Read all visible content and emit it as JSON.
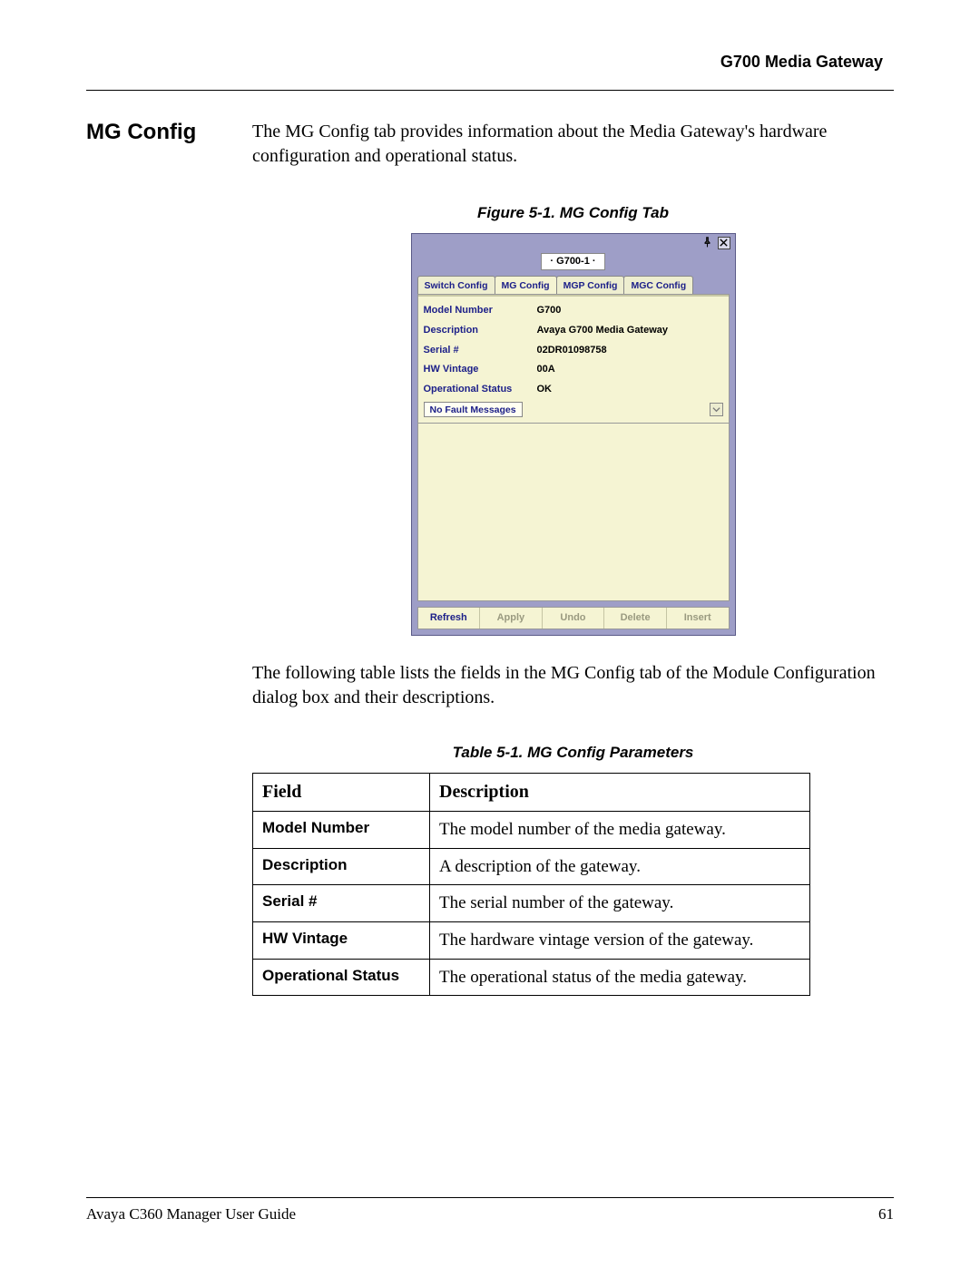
{
  "header": {
    "title": "G700 Media Gateway"
  },
  "section": {
    "heading": "MG Config",
    "intro": "The MG Config tab provides information about the Media Gateway's hardware configuration and operational status."
  },
  "figure": {
    "caption": "Figure 5-1.  MG Config Tab",
    "device_name": "· G700-1 ·",
    "tabs": {
      "switch": "Switch Config",
      "mg": "MG Config",
      "mgp": "MGP Config",
      "mgc": "MGC Config"
    },
    "rows": {
      "model_label": "Model Number",
      "model_value": "G700",
      "desc_label": "Description",
      "desc_value": "Avaya G700 Media Gateway",
      "serial_label": "Serial #",
      "serial_value": "02DR01098758",
      "hw_label": "HW Vintage",
      "hw_value": "00A",
      "op_label": "Operational Status",
      "op_value": "OK"
    },
    "fault": "No Fault Messages",
    "buttons": {
      "refresh": "Refresh",
      "apply": "Apply",
      "undo": "Undo",
      "delete": "Delete",
      "insert": "Insert"
    }
  },
  "post_figure": "The following table lists the fields in the MG Config tab of the Module Configuration dialog box and their descriptions.",
  "table": {
    "caption": "Table 5-1.  MG Config Parameters",
    "headers": {
      "field": "Field",
      "desc": "Description"
    },
    "rows": [
      {
        "field": "Model Number",
        "desc": "The model number of the media gateway."
      },
      {
        "field": "Description",
        "desc": "A description of the gateway."
      },
      {
        "field": "Serial #",
        "desc": "The serial number of the gateway."
      },
      {
        "field": "HW Vintage",
        "desc": "The hardware vintage version of the gateway."
      },
      {
        "field": "Operational Status",
        "desc": "The operational status of the media gateway."
      }
    ]
  },
  "footer": {
    "guide": "Avaya C360 Manager User Guide",
    "page": "61"
  }
}
